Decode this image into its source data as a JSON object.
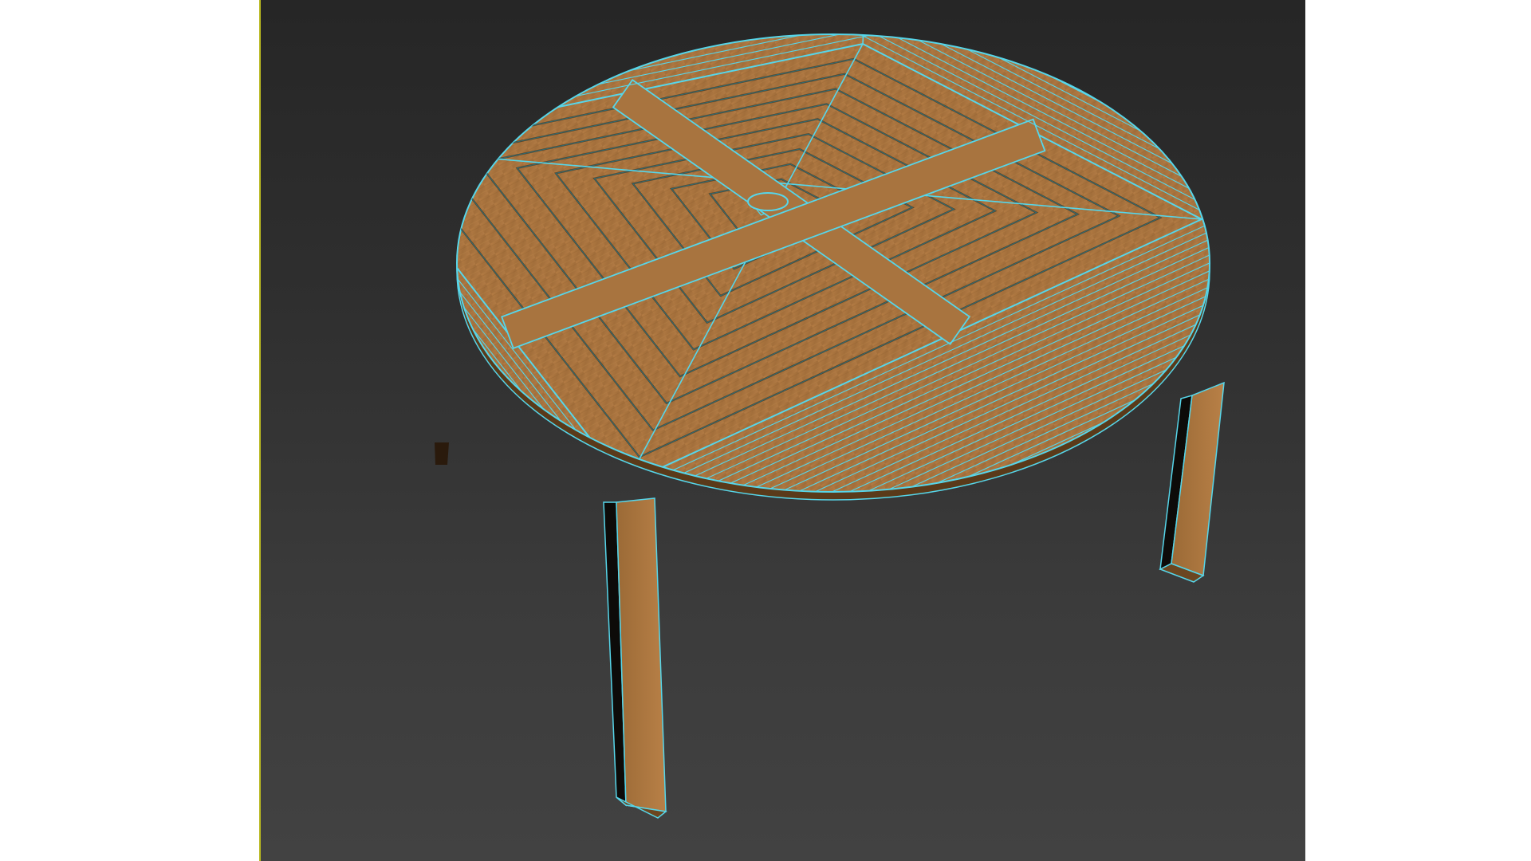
{
  "viewport": {
    "label": "",
    "background_top": "#262626",
    "background_bottom": "#424242",
    "active_border_color": "#b8b820"
  },
  "model": {
    "object": "round-wooden-table",
    "wood_color": "#a8743f",
    "wood_dark": "#7a4f26",
    "wireframe_color": "#56d6ea",
    "shadow_color": "#0c0a08"
  }
}
